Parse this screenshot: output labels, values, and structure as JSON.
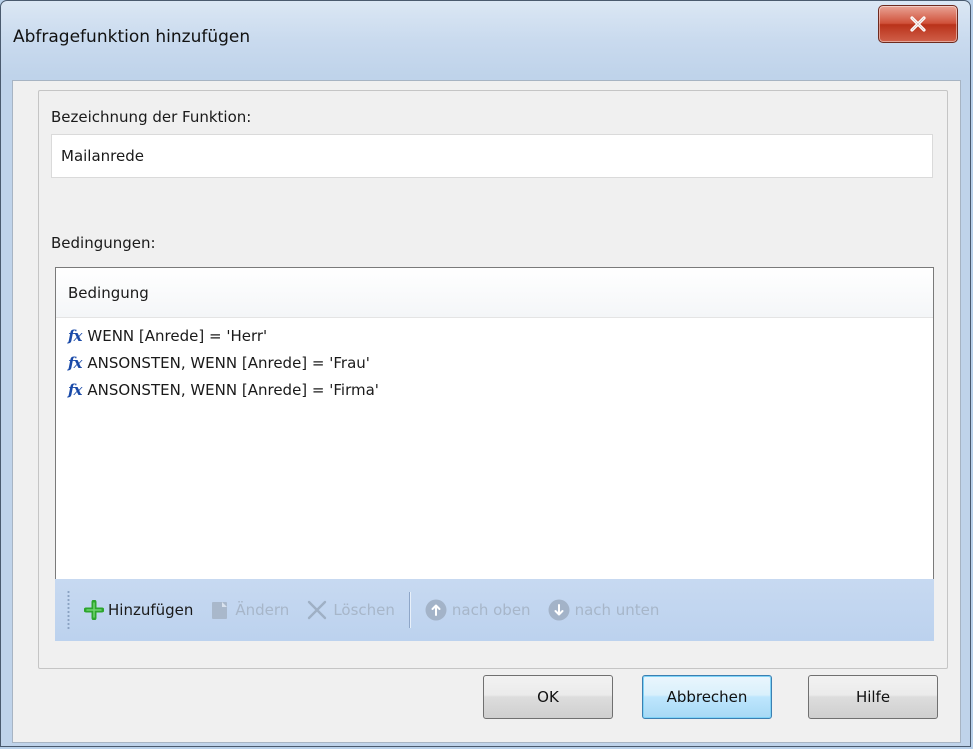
{
  "window": {
    "title": "Abfragefunktion hinzufügen",
    "close_label": "X"
  },
  "form": {
    "name_label": "Bezeichnung der Funktion:",
    "name_value": "Mailanrede",
    "conditions_label": "Bedingungen:"
  },
  "conditions": {
    "column_header": "Bedingung",
    "fx_glyph": "fx",
    "rows": [
      {
        "text": "WENN [Anrede] = 'Herr'"
      },
      {
        "text": "ANSONSTEN, WENN [Anrede] = 'Frau'"
      },
      {
        "text": "ANSONSTEN, WENN [Anrede] = 'Firma'"
      }
    ]
  },
  "toolbar": {
    "add_label": "Hinzufügen",
    "edit_label": "Ändern",
    "delete_label": "Löschen",
    "up_label": "nach oben",
    "down_label": "nach unten"
  },
  "buttons": {
    "ok": "OK",
    "cancel": "Abbrechen",
    "help": "Hilfe"
  },
  "colors": {
    "accent_fx": "#1a4aa8",
    "add_icon": "#2da52d",
    "disabled_text": "#a7b6c9",
    "close_button": "#c9452e"
  },
  "icons": {
    "add": "plus-icon",
    "edit": "edit-document-icon",
    "delete": "delete-x-icon",
    "up": "arrow-up-circle-icon",
    "down": "arrow-down-circle-icon",
    "close": "close-icon"
  }
}
